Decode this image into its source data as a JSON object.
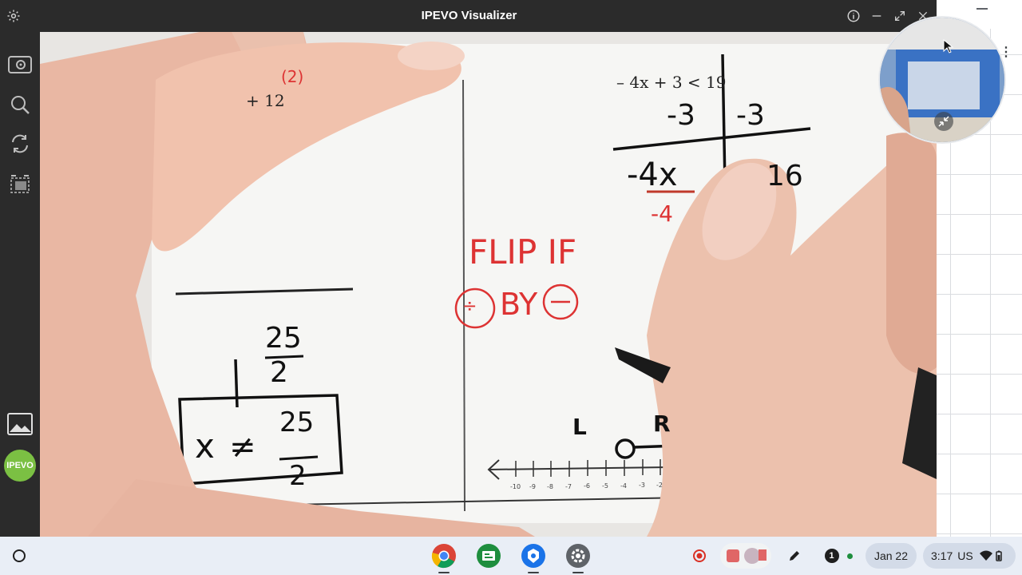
{
  "window": {
    "title": "IPEVO Visualizer",
    "controls": [
      "settings-icon",
      "info-icon",
      "minimize-icon",
      "maximize-icon",
      "close-icon"
    ]
  },
  "sidebar": {
    "tools": [
      "snapshot-icon",
      "zoom-icon",
      "rotate-icon",
      "crop-icon",
      "gallery-icon",
      "ipevo-logo"
    ],
    "logo_text": "IPEVO"
  },
  "camera_view": {
    "left_page": {
      "top_note": "(2)",
      "expr": "+ 12",
      "fraction_num": "25",
      "fraction_den": "2",
      "boxed_var": "x",
      "boxed_symbol": "≠",
      "boxed_num": "25",
      "boxed_den": "2"
    },
    "right_page": {
      "inequality_line": "– 4x + 3 < 19",
      "sub_left": "-3",
      "sub_right": "-3",
      "result_left": "-4x",
      "result_right": "16",
      "divide_left": "-4",
      "note_line1": "FLIP IF",
      "note_line2": "BY",
      "label_L": "L",
      "label_R": "R",
      "number_line_ticks": [
        "-10",
        "-9",
        "-8",
        "-7",
        "-6",
        "-5",
        "-4",
        "-3",
        "-2"
      ]
    }
  },
  "shelf": {
    "launcher_icon": "launcher-icon",
    "apps": [
      "chrome-icon",
      "classroom-app-icon",
      "ipevo-app-icon",
      "settings-app-icon"
    ],
    "tray": {
      "record_icon": "record-icon",
      "pen_icon": "pen-icon",
      "notification_count": "1",
      "date": "Jan 22",
      "time": "3:17",
      "locale": "US"
    }
  }
}
